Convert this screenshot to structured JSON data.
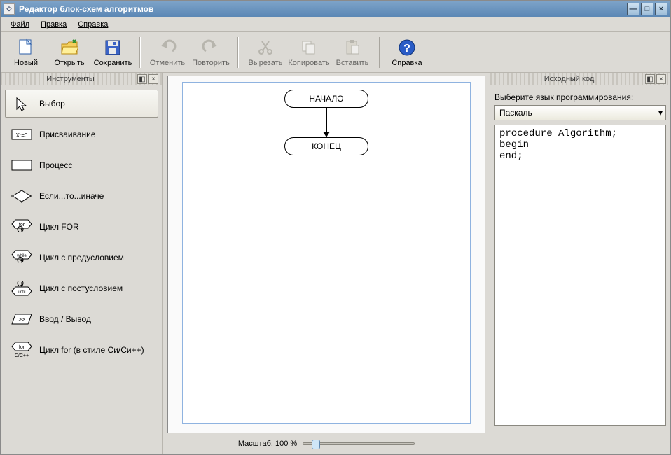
{
  "window": {
    "title": "Редактор блок-схем алгоритмов"
  },
  "menu": {
    "file": "Файл",
    "edit": "Правка",
    "help": "Справка"
  },
  "toolbar": {
    "new": "Новый",
    "open": "Открыть",
    "save": "Сохранить",
    "undo": "Отменить",
    "redo": "Повторить",
    "cut": "Вырезать",
    "copy": "Копировать",
    "paste": "Вставить",
    "help": "Справка"
  },
  "docks": {
    "tools_title": "Инструменты",
    "source_title": "Исходный код"
  },
  "tools": [
    {
      "label": "Выбор",
      "selected": true
    },
    {
      "label": "Присваивание",
      "selected": false
    },
    {
      "label": "Процесс",
      "selected": false
    },
    {
      "label": "Если...то...иначе",
      "selected": false
    },
    {
      "label": "Цикл FOR",
      "selected": false
    },
    {
      "label": "Цикл с предусловием",
      "selected": false
    },
    {
      "label": "Цикл с постусловием",
      "selected": false
    },
    {
      "label": "Ввод / Вывод",
      "selected": false
    },
    {
      "label": "Цикл for (в стиле Си/Си++)",
      "selected": false
    }
  ],
  "flow": {
    "start": "НАЧАЛО",
    "end": "КОНЕЦ"
  },
  "zoom": {
    "label": "Масштаб: 100 %"
  },
  "source": {
    "lang_label": "Выберите язык программирования:",
    "lang_selected": "Паскаль",
    "code": "procedure Algorithm;\nbegin\nend;"
  }
}
